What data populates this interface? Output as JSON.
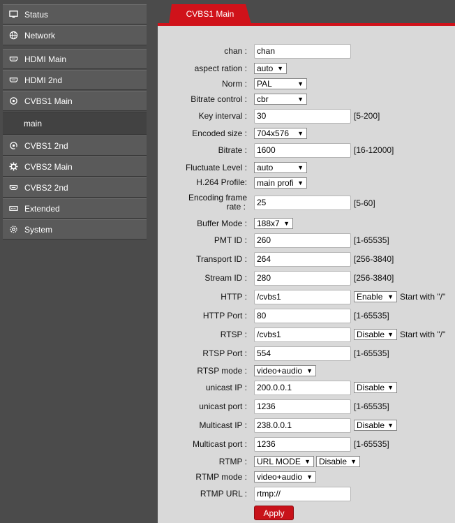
{
  "sidebar": {
    "items": [
      {
        "label": "Status",
        "icon": "monitor-icon"
      },
      {
        "label": "Network",
        "icon": "globe-icon"
      },
      {
        "label": "HDMI Main",
        "icon": "hdmi-icon"
      },
      {
        "label": "HDMI 2nd",
        "icon": "hdmi-icon"
      },
      {
        "label": "CVBS1 Main",
        "icon": "target-icon"
      },
      {
        "label": "main",
        "icon": ""
      },
      {
        "label": "CVBS1 2nd",
        "icon": "target-icon"
      },
      {
        "label": "CVBS2 Main",
        "icon": "gear-icon"
      },
      {
        "label": "CVBS2 2nd",
        "icon": "hdmi-icon"
      },
      {
        "label": "Extended",
        "icon": "port-icon"
      },
      {
        "label": "System",
        "icon": "cog-icon"
      }
    ]
  },
  "tab": {
    "label": "CVBS1 Main"
  },
  "form": {
    "chan": {
      "label": "chan :",
      "value": "chan"
    },
    "aspect": {
      "label": "aspect ration :",
      "value": "auto"
    },
    "norm": {
      "label": "Norm :",
      "value": "PAL"
    },
    "bitrate_control": {
      "label": "Bitrate control :",
      "value": "cbr"
    },
    "key_interval": {
      "label": "Key interval :",
      "value": "30",
      "hint": "[5-200]"
    },
    "encoded_size": {
      "label": "Encoded size :",
      "value": "704x576"
    },
    "bitrate": {
      "label": "Bitrate :",
      "value": "1600",
      "hint": "[16-12000]"
    },
    "fluctuate": {
      "label": "Fluctuate Level :",
      "value": "auto"
    },
    "h264_profile": {
      "label": "H.264 Profile:",
      "value": "main profi"
    },
    "frame_rate": {
      "label_line1": "Encoding frame",
      "label_line2": "rate :",
      "value": "25",
      "hint": "[5-60]"
    },
    "buffer_mode": {
      "label": "Buffer Mode :",
      "value": "188x7"
    },
    "pmt_id": {
      "label": "PMT ID :",
      "value": "260",
      "hint": "[1-65535]"
    },
    "transport_id": {
      "label": "Transport ID :",
      "value": "264",
      "hint": "[256-3840]"
    },
    "stream_id": {
      "label": "Stream ID :",
      "value": "280",
      "hint": "[256-3840]"
    },
    "http": {
      "label": "HTTP :",
      "value": "/cvbs1",
      "select": "Enable",
      "hint": "Start with \"/\""
    },
    "http_port": {
      "label": "HTTP Port :",
      "value": "80",
      "hint": "[1-65535]"
    },
    "rtsp": {
      "label": "RTSP :",
      "value": "/cvbs1",
      "select": "Disable",
      "hint": "Start with \"/\""
    },
    "rtsp_port": {
      "label": "RTSP Port :",
      "value": "554",
      "hint": "[1-65535]"
    },
    "rtsp_mode": {
      "label": "RTSP mode :",
      "value": "video+audio"
    },
    "unicast_ip": {
      "label": "unicast IP :",
      "value": "200.0.0.1",
      "select": "Disable"
    },
    "unicast_port": {
      "label": "unicast port :",
      "value": "1236",
      "hint": "[1-65535]"
    },
    "multicast_ip": {
      "label": "Multicast IP :",
      "value": "238.0.0.1",
      "select": "Disable"
    },
    "multicast_port": {
      "label": "Multicast port :",
      "value": "1236",
      "hint": "[1-65535]"
    },
    "rtmp": {
      "label": "RTMP :",
      "mode": "URL MODE",
      "select": "Disable"
    },
    "rtmp_mode": {
      "label": "RTMP mode :",
      "value": "video+audio"
    },
    "rtmp_url": {
      "label": "RTMP URL :",
      "value": "rtmp://"
    }
  },
  "apply_label": "Apply",
  "colors": {
    "accent": "#d0121a",
    "panel": "#d9d9d9",
    "sidebar": "#4b4b4b"
  }
}
